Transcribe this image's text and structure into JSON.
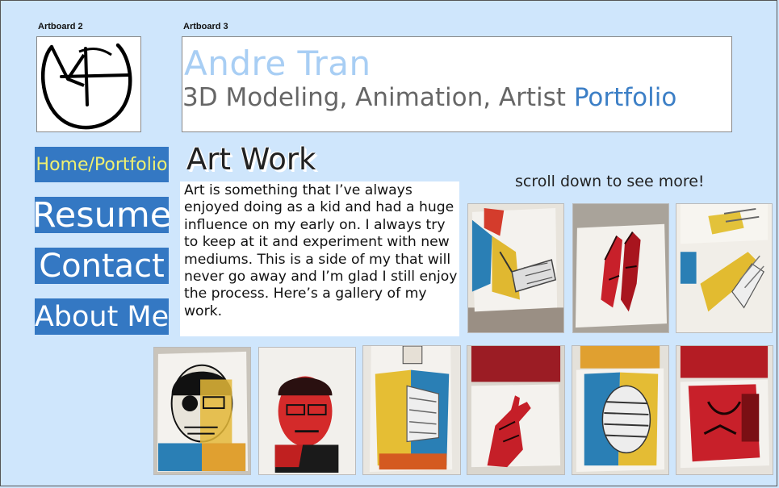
{
  "artboards": {
    "left": "Artboard 2",
    "right": "Artboard 3"
  },
  "header": {
    "name": "Andre Tran",
    "subtitle": "3D Modeling, Animation, Artist",
    "subtitle_accent": "Portfolio"
  },
  "nav": {
    "home": "Home/Portfolio",
    "resume": "Resume",
    "contact": "Contact",
    "about": "About Me"
  },
  "main": {
    "title": "Art Work",
    "description": "Art is something that I’ve always enjoyed doing as a kid and had a huge influence on my early on. I always try to keep at it and experiment with new mediums. This is a side of my that will never go away and I’m glad I still enjoy the process. Here’s a gallery of my work.",
    "scroll_hint": "scroll down to see more!"
  },
  "colors": {
    "page_bg": "#cfe6fc",
    "nav_bg": "#3478c3",
    "nav_active_text": "#f0f070",
    "name_color": "#a8cef4",
    "accent": "#3c7fc6"
  },
  "gallery": [
    {
      "name": "painting-feet-skeleton"
    },
    {
      "name": "painting-red-hands"
    },
    {
      "name": "painting-skeleton-hand"
    },
    {
      "name": "painting-skull-portrait"
    },
    {
      "name": "painting-red-portrait"
    },
    {
      "name": "painting-torso-skeleton"
    },
    {
      "name": "painting-red-pointing-hand"
    },
    {
      "name": "painting-ribcage-torso"
    },
    {
      "name": "painting-red-torso"
    }
  ]
}
